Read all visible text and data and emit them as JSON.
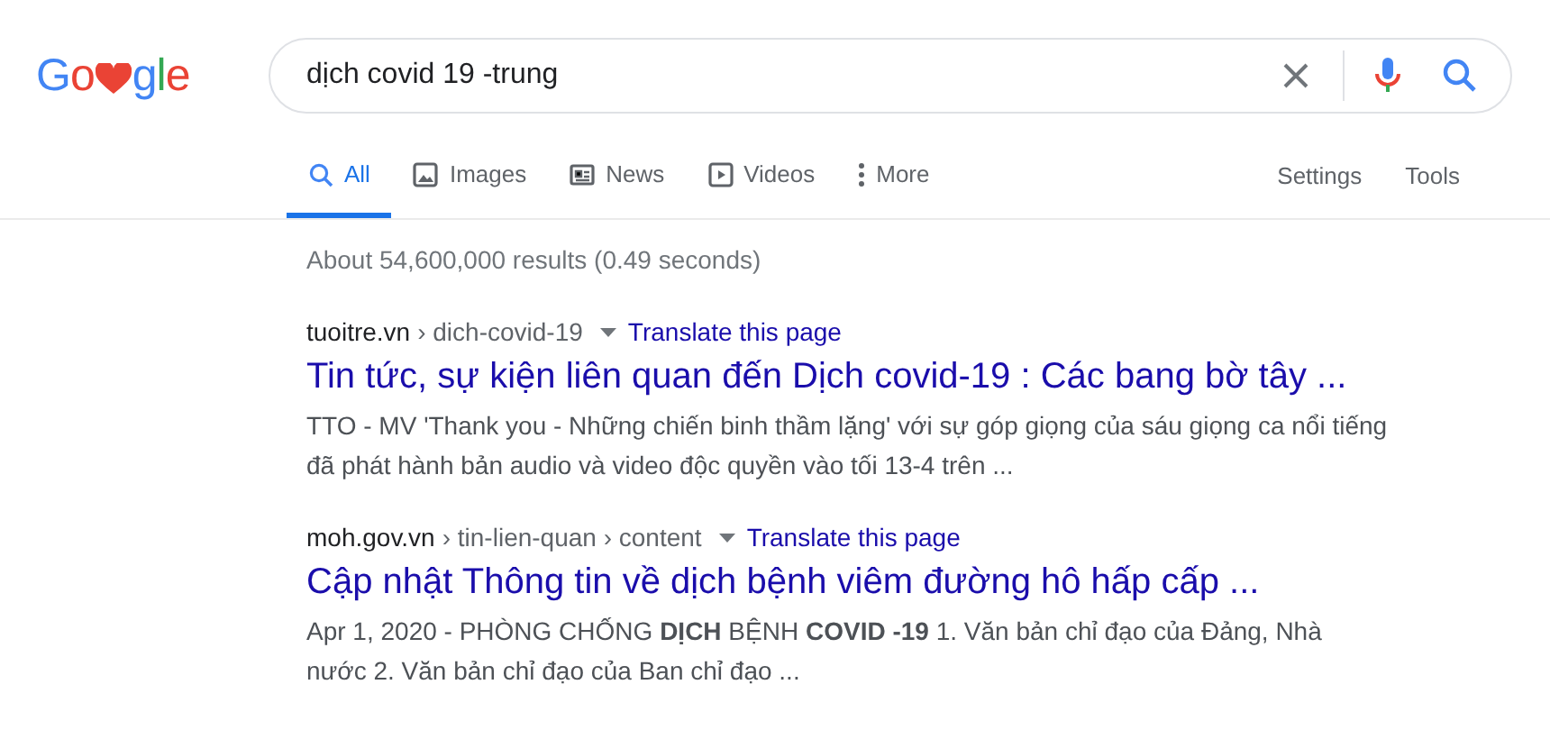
{
  "logo": {
    "before": "Go",
    "after": "gle"
  },
  "search": {
    "value": "dịch covid 19 -trung"
  },
  "tabs": [
    {
      "label": "All",
      "kind": "search",
      "selected": true
    },
    {
      "label": "Images",
      "kind": "image",
      "selected": false
    },
    {
      "label": "News",
      "kind": "news",
      "selected": false
    },
    {
      "label": "Videos",
      "kind": "video",
      "selected": false
    },
    {
      "label": "More",
      "kind": "dots",
      "selected": false
    }
  ],
  "tools": [
    "Settings",
    "Tools"
  ],
  "stats": "About 54,600,000 results (0.49 seconds)",
  "results": [
    {
      "domain": "tuoitre.vn",
      "path": "› dich-covid-19",
      "translate": "Translate this page",
      "title": "Tin tức, sự kiện liên quan đến Dịch covid-19 : Các bang bờ tây ...",
      "snippet": "TTO - MV 'Thank you - Những chiến binh thầm lặng' với sự góp giọng của sáu giọng ca nổi tiếng đã phát hành bản audio và video độc quyền vào tối 13-4 trên ..."
    },
    {
      "domain": "moh.gov.vn",
      "path": "› tin-lien-quan › content",
      "translate": "Translate this page",
      "title": "Cập nhật Thông tin về dịch bệnh viêm đường hô hấp cấp ...",
      "snippet": "Apr 1, 2020 - PHÒNG CHỐNG **DỊCH** BỆNH **COVID -19** 1. Văn bản chỉ đạo của Đảng, Nhà nước 2. Văn bản chỉ đạo của Ban chỉ đạo ..."
    }
  ]
}
